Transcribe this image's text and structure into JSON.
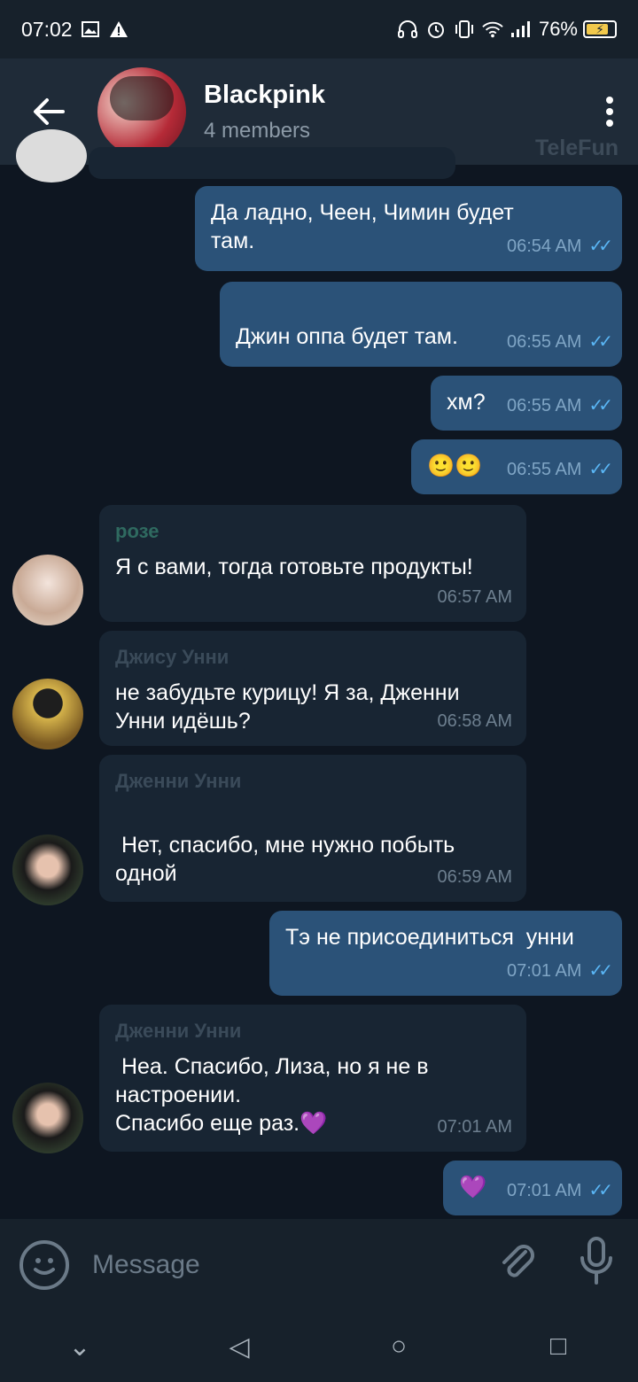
{
  "status_bar": {
    "time": "07:02",
    "battery": "76%",
    "icons": [
      "image-icon",
      "warning-icon",
      "headphones-icon",
      "alarm-icon",
      "vibrate-icon",
      "wifi-icon",
      "signal-icon",
      "battery-charging-icon"
    ]
  },
  "header": {
    "title": "Blackpink",
    "subtitle": "4 members",
    "watermark": "TeleFun"
  },
  "messages": [
    {
      "dir": "out",
      "text": "Да ладно, Чеен, Чимин будет\nтам.",
      "time": "06:54 AM"
    },
    {
      "dir": "out",
      "text": "\nДжин оппа будет там.",
      "time": "06:55 AM"
    },
    {
      "dir": "out",
      "text": "хм?",
      "time": "06:55 AM"
    },
    {
      "dir": "out",
      "text": "🙂🙂",
      "time": "06:55 AM"
    },
    {
      "dir": "in",
      "sender": "розе",
      "text": "Я с вами, тогда готовьте продукты!",
      "time": "06:57 AM"
    },
    {
      "dir": "in",
      "sender": "Джису Унни",
      "text": "не забудьте курицу! Я за, Дженни\nУнни идёшь?",
      "time": "06:58 AM"
    },
    {
      "dir": "in",
      "sender": "Дженни Унни",
      "text": "\n Нет, спасибо, мне нужно побыть\nодной",
      "time": "06:59 AM"
    },
    {
      "dir": "out",
      "text": "Тэ не присоединиться  унни",
      "time": "07:01 AM"
    },
    {
      "dir": "in",
      "sender": "Дженни Унни",
      "text": " Неа. Спасибо, Лиза, но я не в\nнастроении.\nСпасибо еще раз.💜",
      "time": "07:01 AM"
    },
    {
      "dir": "out",
      "text": "💜",
      "time": "07:01 AM"
    }
  ],
  "input": {
    "placeholder": "Message"
  },
  "nav": {
    "down": "⌄",
    "back": "◁",
    "home": "○",
    "recent": "□"
  }
}
